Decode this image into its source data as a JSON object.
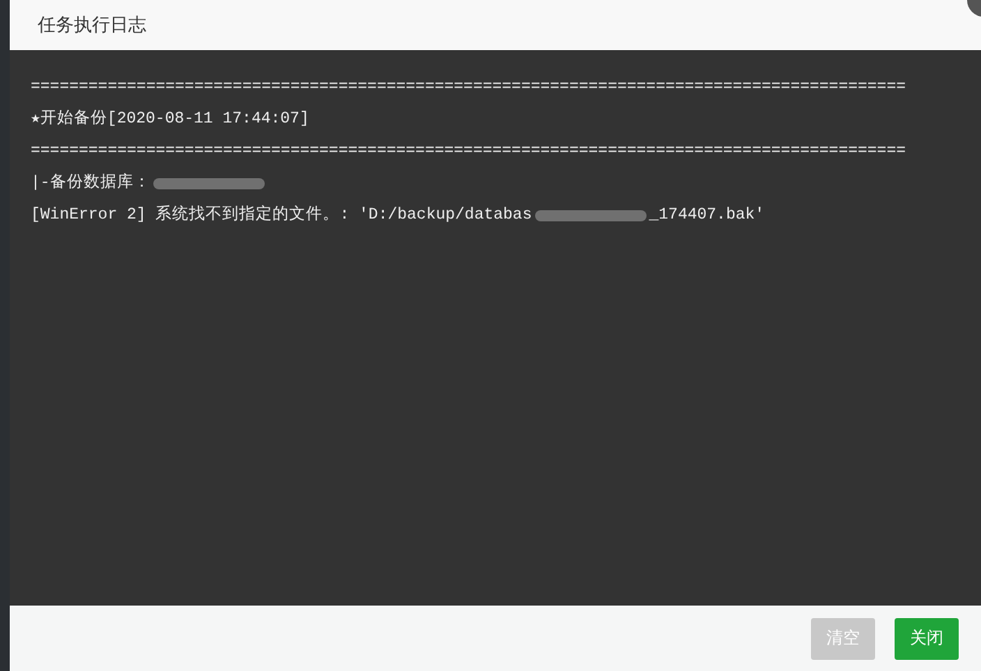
{
  "dialog": {
    "title": "任务执行日志"
  },
  "log_lines": [
    {
      "kind": "plain",
      "text": "==========================================================================================="
    },
    {
      "kind": "plain",
      "text": "★开始备份[2020-08-11 17:44:07]"
    },
    {
      "kind": "plain",
      "text": "==========================================================================================="
    },
    {
      "kind": "redacted",
      "text": "|-备份数据库："
    },
    {
      "kind": "redacted",
      "text": "[WinError 2] 系统找不到指定的文件。: 'D:/backup/databas",
      "after": "_174407.bak'"
    }
  ],
  "buttons": [
    {
      "label": "清空",
      "disabled": true
    },
    {
      "label": "关闭",
      "disabled": false
    }
  ]
}
